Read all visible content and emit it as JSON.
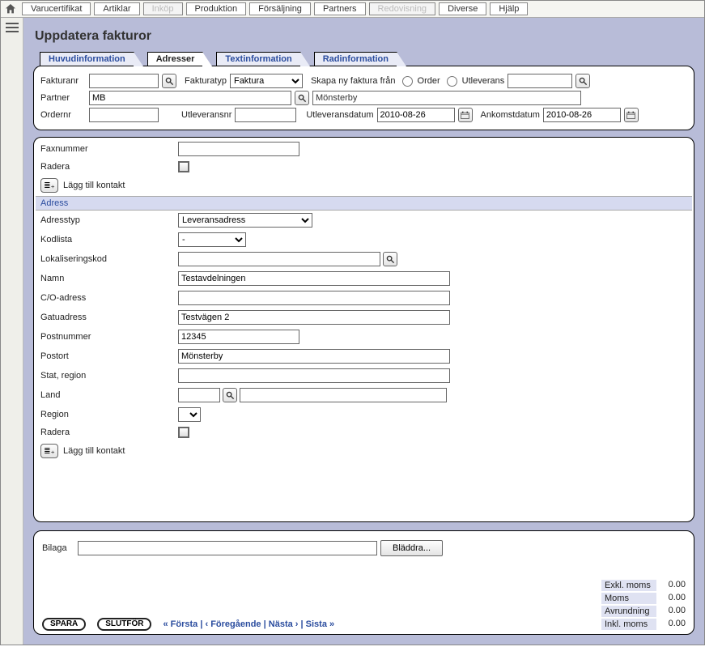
{
  "topTabs": [
    {
      "label": "Varucertifikat",
      "disabled": false
    },
    {
      "label": "Artiklar",
      "disabled": false
    },
    {
      "label": "Inköp",
      "disabled": true
    },
    {
      "label": "Produktion",
      "disabled": false
    },
    {
      "label": "Försäljning",
      "disabled": false
    },
    {
      "label": "Partners",
      "disabled": false
    },
    {
      "label": "Redovisning",
      "disabled": true
    },
    {
      "label": "Diverse",
      "disabled": false
    },
    {
      "label": "Hjälp",
      "disabled": false
    }
  ],
  "pageTitle": "Uppdatera fakturor",
  "subTabs": [
    {
      "label": "Huvudinformation",
      "active": false
    },
    {
      "label": "Adresser",
      "active": true
    },
    {
      "label": "Textinformation",
      "active": false
    },
    {
      "label": "Radinformation",
      "active": false
    }
  ],
  "header": {
    "fakturanr_label": "Fakturanr",
    "fakturanr": "",
    "fakturatyp_label": "Fakturatyp",
    "fakturatyp_value": "Faktura",
    "skapa_label": "Skapa ny faktura från",
    "order_label": "Order",
    "utleverans_label": "Utleverans",
    "utleverans_value": "",
    "partner_label": "Partner",
    "partner_code": "MB",
    "partner_name": "Mönsterby",
    "ordernr_label": "Ordernr",
    "ordernr": "",
    "utleveransnr_label": "Utleveransnr",
    "utleveransnr": "",
    "utleveransdatum_label": "Utleveransdatum",
    "utleveransdatum": "2010-08-26",
    "ankomstdatum_label": "Ankomstdatum",
    "ankomstdatum": "2010-08-26"
  },
  "contact": {
    "fax_label": "Faxnummer",
    "fax": "",
    "radera_label": "Radera",
    "addContact": "Lägg till kontakt"
  },
  "address": {
    "section": "Adress",
    "adresstyp_label": "Adresstyp",
    "adresstyp_value": "Leveransadress",
    "kodlista_label": "Kodlista",
    "kodlista_value": "-",
    "lokkod_label": "Lokaliseringskod",
    "lokkod": "",
    "namn_label": "Namn",
    "namn": "Testavdelningen",
    "co_label": "C/O-adress",
    "co": "",
    "gatu_label": "Gatuadress",
    "gatu": "Testvägen 2",
    "postnr_label": "Postnummer",
    "postnr": "12345",
    "postort_label": "Postort",
    "postort": "Mönsterby",
    "stat_label": "Stat, region",
    "stat": "",
    "land_label": "Land",
    "land_code": "",
    "land_name": "",
    "region_label": "Region",
    "radera_label": "Radera",
    "addContact": "Lägg till kontakt"
  },
  "footer": {
    "bilaga_label": "Bilaga",
    "browse": "Bläddra...",
    "spara": "SPARA",
    "slutfor": "SLUTFÖR",
    "nav_first": "« Första",
    "nav_prev": "‹ Föregående",
    "nav_next": "Nästa ›",
    "nav_last": "Sista »",
    "totals": [
      {
        "label": "Exkl. moms",
        "value": "0.00"
      },
      {
        "label": "Moms",
        "value": "0.00"
      },
      {
        "label": "Avrundning",
        "value": "0.00"
      },
      {
        "label": "Inkl. moms",
        "value": "0.00"
      }
    ]
  }
}
